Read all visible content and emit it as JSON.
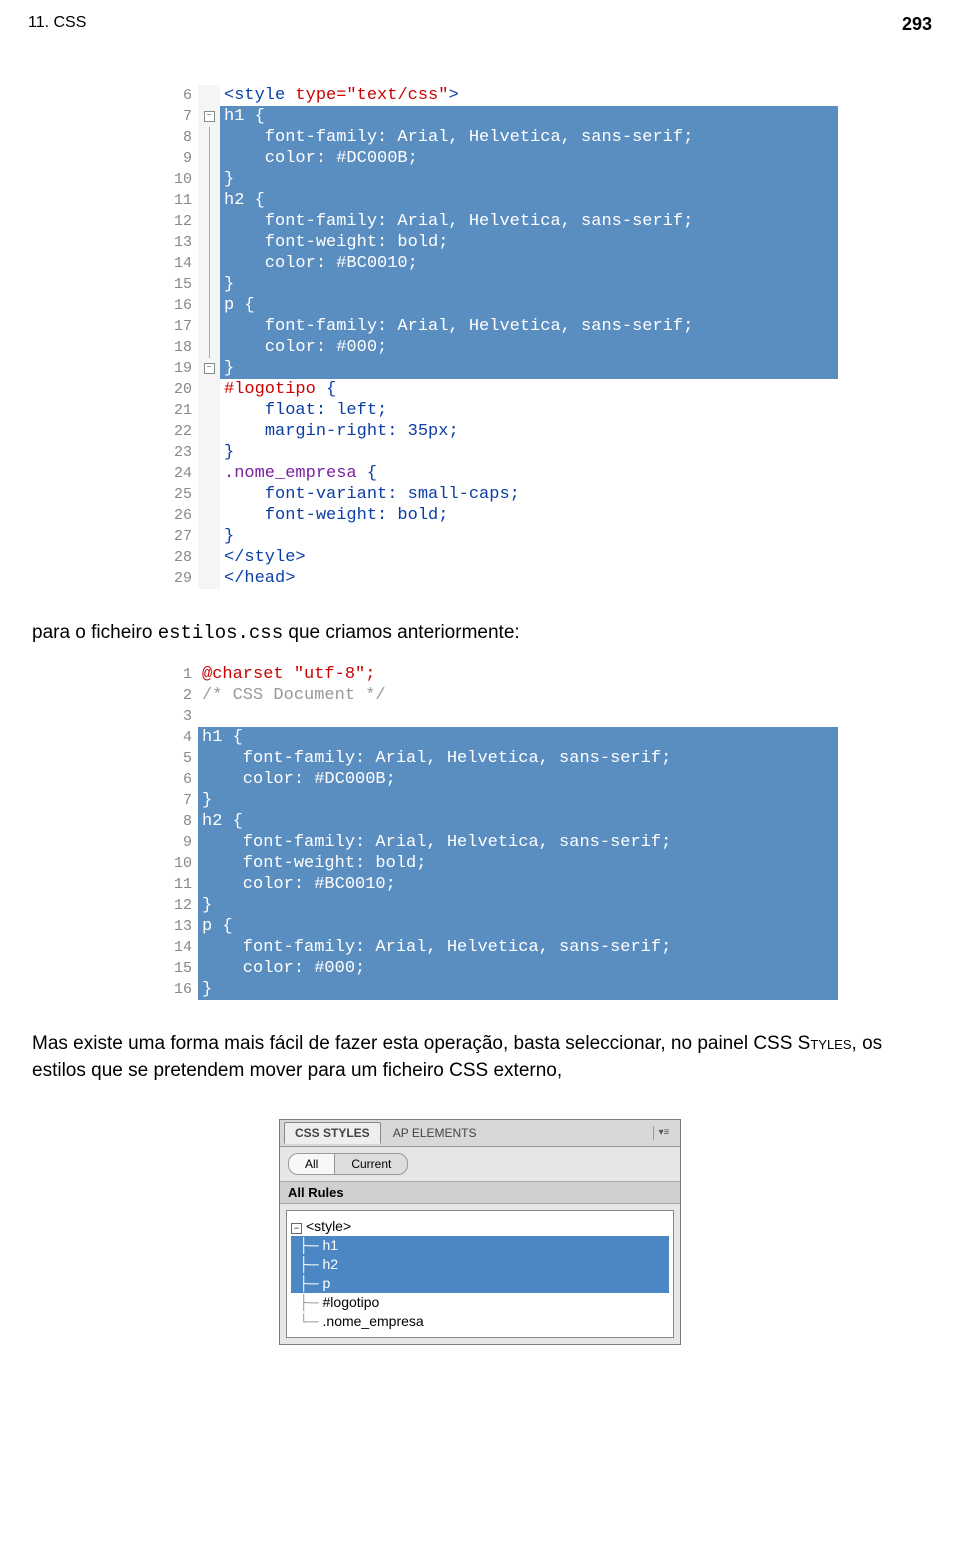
{
  "header": {
    "chapter": "11. CSS",
    "page": "293"
  },
  "code1": {
    "lines": [
      {
        "n": "6",
        "fold": "",
        "hl": false,
        "html": "<span class='tag'>&lt;style</span> <span class='attr'>type=\"text/css\"</span><span class='tag'>&gt;</span>"
      },
      {
        "n": "7",
        "fold": "box",
        "hl": true,
        "html": "h1 {"
      },
      {
        "n": "8",
        "fold": "|",
        "hl": true,
        "html": "    font-family: Arial, Helvetica, sans-serif;"
      },
      {
        "n": "9",
        "fold": "|",
        "hl": true,
        "html": "    color: #DC000B;"
      },
      {
        "n": "10",
        "fold": "|",
        "hl": true,
        "html": "}"
      },
      {
        "n": "11",
        "fold": "|",
        "hl": true,
        "html": "h2 {"
      },
      {
        "n": "12",
        "fold": "|",
        "hl": true,
        "html": "    font-family: Arial, Helvetica, sans-serif;"
      },
      {
        "n": "13",
        "fold": "|",
        "hl": true,
        "html": "    font-weight: bold;"
      },
      {
        "n": "14",
        "fold": "|",
        "hl": true,
        "html": "    color: #BC0010;"
      },
      {
        "n": "15",
        "fold": "|",
        "hl": true,
        "html": "}"
      },
      {
        "n": "16",
        "fold": "|",
        "hl": true,
        "html": "p {"
      },
      {
        "n": "17",
        "fold": "|",
        "hl": true,
        "html": "    font-family: Arial, Helvetica, sans-serif;"
      },
      {
        "n": "18",
        "fold": "|",
        "hl": true,
        "html": "    color: #000;"
      },
      {
        "n": "19",
        "fold": "box",
        "hl": true,
        "html": "}"
      },
      {
        "n": "20",
        "fold": "",
        "hl": false,
        "html": "<span class='attr'>#logotipo</span> <span class='tag'>{</span>"
      },
      {
        "n": "21",
        "fold": "",
        "hl": false,
        "html": "    <span class='tag'>float: left;</span>"
      },
      {
        "n": "22",
        "fold": "",
        "hl": false,
        "html": "    <span class='tag'>margin-right: 35px;</span>"
      },
      {
        "n": "23",
        "fold": "",
        "hl": false,
        "html": "<span class='tag'>}</span>"
      },
      {
        "n": "24",
        "fold": "",
        "hl": false,
        "html": "<span class='cls'>.nome_empresa</span> <span class='tag'>{</span>"
      },
      {
        "n": "25",
        "fold": "",
        "hl": false,
        "html": "    <span class='tag'>font-variant: small-caps;</span>"
      },
      {
        "n": "26",
        "fold": "",
        "hl": false,
        "html": "    <span class='tag'>font-weight: bold;</span>"
      },
      {
        "n": "27",
        "fold": "",
        "hl": false,
        "html": "<span class='tag'>}</span>"
      },
      {
        "n": "28",
        "fold": "",
        "hl": false,
        "html": "<span class='tag'>&lt;/style&gt;</span>"
      },
      {
        "n": "29",
        "fold": "",
        "hl": false,
        "html": "<span class='tag'>&lt;/head&gt;</span>"
      }
    ]
  },
  "para1_a": "para o ficheiro ",
  "para1_b": "estilos.css",
  "para1_c": " que criamos anteriormente:",
  "code2": {
    "lines": [
      {
        "n": "1",
        "hl": false,
        "html": "<span class='attr'>@charset \"utf-8\";</span>"
      },
      {
        "n": "2",
        "hl": false,
        "html": "<span class='comment'>/* CSS Document */</span>"
      },
      {
        "n": "3",
        "hl": false,
        "html": ""
      },
      {
        "n": "4",
        "hl": true,
        "html": "h1 {"
      },
      {
        "n": "5",
        "hl": true,
        "html": "    font-family: Arial, Helvetica, sans-serif;"
      },
      {
        "n": "6",
        "hl": true,
        "html": "    color: #DC000B;"
      },
      {
        "n": "7",
        "hl": true,
        "html": "}"
      },
      {
        "n": "8",
        "hl": true,
        "html": "h2 {"
      },
      {
        "n": "9",
        "hl": true,
        "html": "    font-family: Arial, Helvetica, sans-serif;"
      },
      {
        "n": "10",
        "hl": true,
        "html": "    font-weight: bold;"
      },
      {
        "n": "11",
        "hl": true,
        "html": "    color: #BC0010;"
      },
      {
        "n": "12",
        "hl": true,
        "html": "}"
      },
      {
        "n": "13",
        "hl": true,
        "html": "p {"
      },
      {
        "n": "14",
        "hl": true,
        "html": "    font-family: Arial, Helvetica, sans-serif;"
      },
      {
        "n": "15",
        "hl": true,
        "html": "    color: #000;"
      },
      {
        "n": "16",
        "hl": true,
        "html": "}"
      }
    ]
  },
  "para2_a": "Mas existe uma forma mais fácil de fazer esta operação, basta seleccionar, no painel CSS ",
  "para2_b": "Styles",
  "para2_c": ", os estilos que se pretendem mover para um ficheiro CSS externo,",
  "panel": {
    "tab1": "CSS STYLES",
    "tab2": "AP ELEMENTS",
    "btnAll": "All",
    "btnCurrent": "Current",
    "rulesHeader": "All Rules",
    "tree": {
      "root": "<style>",
      "items": [
        "h1",
        "h2",
        "p",
        "#logotipo",
        ".nome_empresa"
      ]
    }
  }
}
